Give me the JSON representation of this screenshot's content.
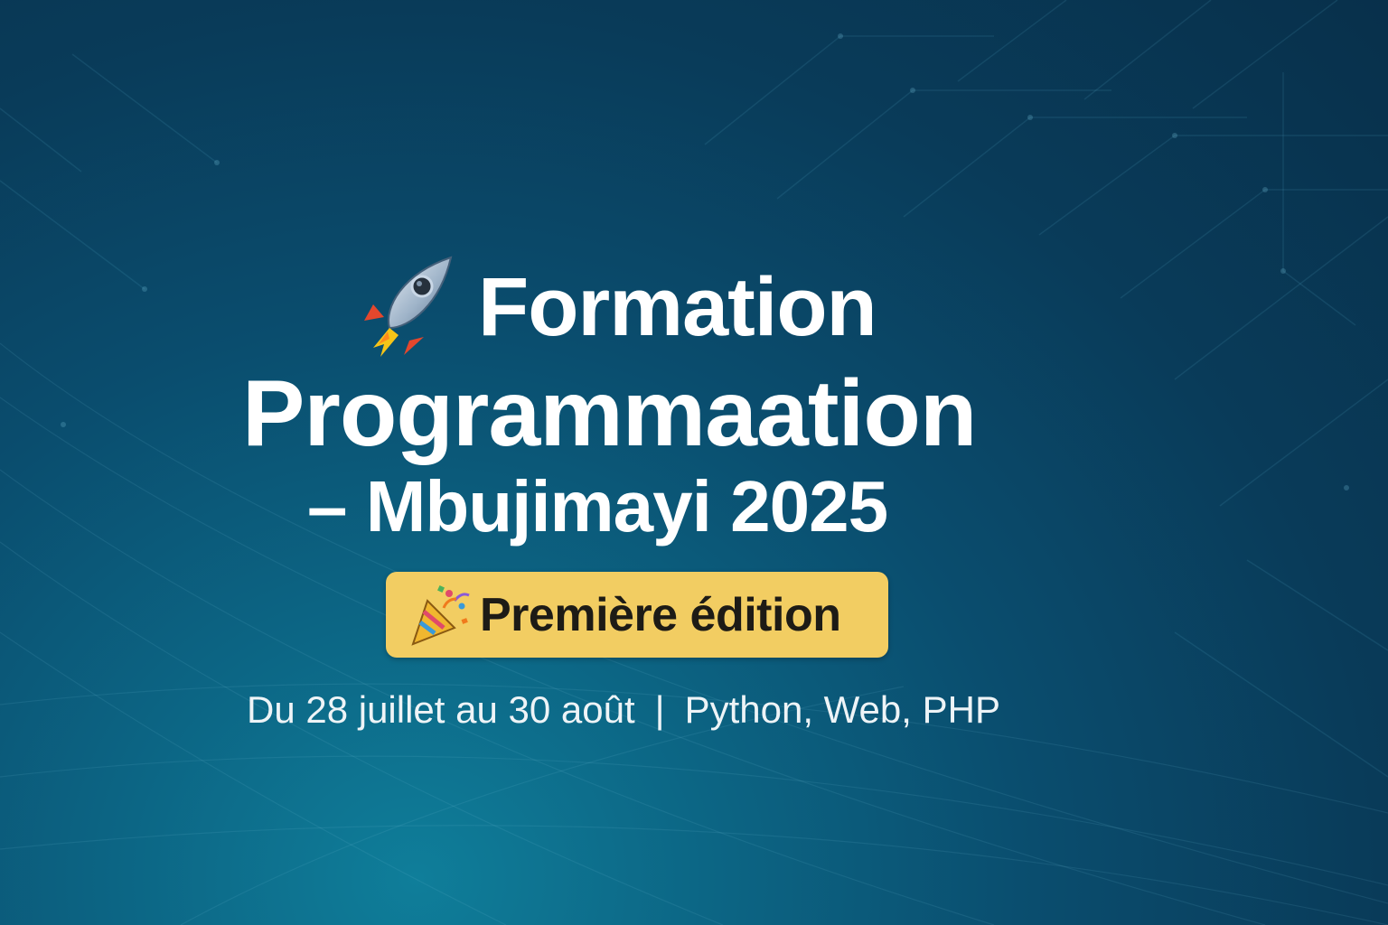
{
  "title": {
    "line1": "Formation",
    "line2": "Programmaation",
    "line3": "– Mbujimayi 2025",
    "icon": "rocket-icon"
  },
  "badge": {
    "label": "Première édition",
    "icon": "party-popper-icon",
    "background_color": "#f2cd62"
  },
  "details": {
    "dates": "Du 28 juillet au 30 août",
    "separator": "|",
    "topics": "Python, Web, PHP"
  },
  "colors": {
    "background_dark": "#08304b",
    "background_light": "#0f7e9a",
    "text": "#ffffff"
  }
}
